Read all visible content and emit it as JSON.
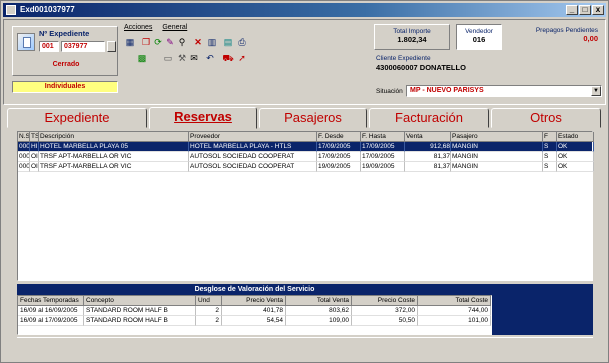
{
  "window": {
    "title": "Exd001037977",
    "min_label": "_",
    "max_label": "□",
    "close_label": "x"
  },
  "expediente": {
    "label": "Nº Expediente",
    "serie": "001",
    "numero": "037977",
    "estado": "Cerrado",
    "tipo": "Individuales"
  },
  "menu": {
    "acciones": "Acciones",
    "general": "General"
  },
  "toolbar": {
    "icons": [
      "new-icon",
      "copy-icon",
      "refresh-icon",
      "edit-icon",
      "search-icon",
      "delete-icon",
      "chart-icon",
      "calendar-icon",
      "print-icon",
      "excel-icon",
      "document-icon",
      "tools-icon",
      "email-icon",
      "undo-icon",
      "car-icon",
      "export-icon"
    ]
  },
  "totals": {
    "importe_label": "Total Importe",
    "importe_value": "1.802,34",
    "vendedor_label": "Vendedor",
    "vendedor_value": "016",
    "prepagos_label": "Prepagos Pendientes",
    "prepagos_value": "0,00"
  },
  "cliente": {
    "label": "Cliente Expediente",
    "value": "4300060007 DONATELLO"
  },
  "situacion": {
    "label": "Situación",
    "value": "MP - NUEVO PARISYS"
  },
  "tabs": [
    {
      "label": "Expediente"
    },
    {
      "label": "Reservas"
    },
    {
      "label": "Pasajeros"
    },
    {
      "label": "Facturación"
    },
    {
      "label": "Otros"
    }
  ],
  "reservas": {
    "headers": [
      "N.Sv",
      "TS",
      "Descripción",
      "Proveedor",
      "F. Desde",
      "F. Hasta",
      "Venta",
      "Pasajero",
      "F",
      "Estado"
    ],
    "rows": [
      [
        "0001",
        "HI",
        "HOTEL MARBELLA PLAYA 05",
        "HOTEL MARBELLA PLAYA - HTLS",
        "17/09/2005",
        "17/09/2005",
        "912,68",
        "MANGIN",
        "S",
        "OK"
      ],
      [
        "0002",
        "OI",
        "TRSF APT-MARBELLA OR VIC",
        "AUTOSOL SOCIEDAD COOPERAT",
        "17/09/2005",
        "17/09/2005",
        "81,37",
        "MANGIN",
        "S",
        "OK"
      ],
      [
        "0003",
        "OI",
        "TRSF APT-MARBELLA OR VIC",
        "AUTOSOL SOCIEDAD COOPERAT",
        "19/09/2005",
        "19/09/2005",
        "81,37",
        "MANGIN",
        "S",
        "OK"
      ]
    ]
  },
  "desglose": {
    "title": "Desglose de Valoración del Servicio",
    "headers": [
      "Fechas Temporadas",
      "Concepto",
      "Und",
      "Precio Venta",
      "Total Venta",
      "Precio Coste",
      "Total Coste"
    ],
    "rows": [
      [
        "16/09 al 16/09/2005",
        "STANDARD ROOM HALF B",
        "2",
        "401,78",
        "803,62",
        "372,00",
        "744,00"
      ],
      [
        "16/09 al 17/09/2005",
        "STANDARD ROOM HALF B",
        "2",
        "54,54",
        "109,00",
        "50,50",
        "101,00"
      ]
    ]
  }
}
